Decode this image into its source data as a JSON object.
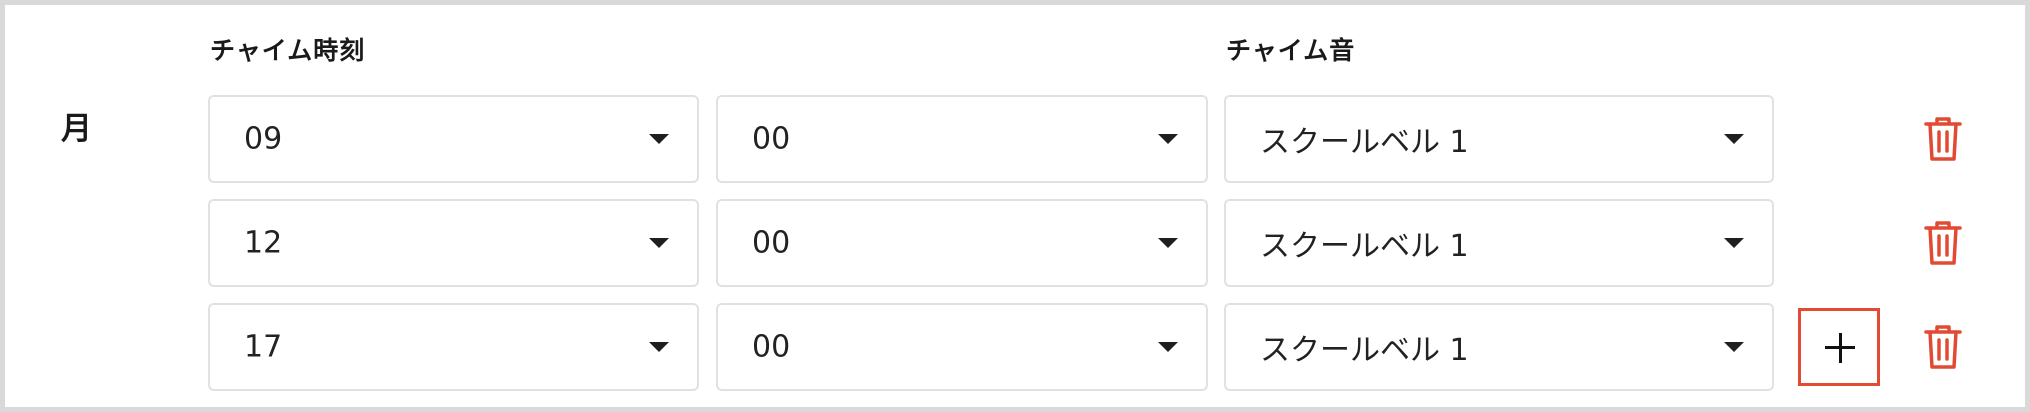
{
  "headers": {
    "chime_time": "チャイム時刻",
    "chime_sound": "チャイム音"
  },
  "day": "月",
  "rows": [
    {
      "hour": "09",
      "minute": "00",
      "sound": "スクールベル 1"
    },
    {
      "hour": "12",
      "minute": "00",
      "sound": "スクールベル 1"
    },
    {
      "hour": "17",
      "minute": "00",
      "sound": "スクールベル 1"
    }
  ],
  "colors": {
    "accent": "#e24a33",
    "border": "#e1e1e1",
    "panel_border": "#d9d9d9"
  },
  "icons": {
    "delete": "trash-icon",
    "add": "plus-icon",
    "dropdown": "caret-down-icon"
  }
}
